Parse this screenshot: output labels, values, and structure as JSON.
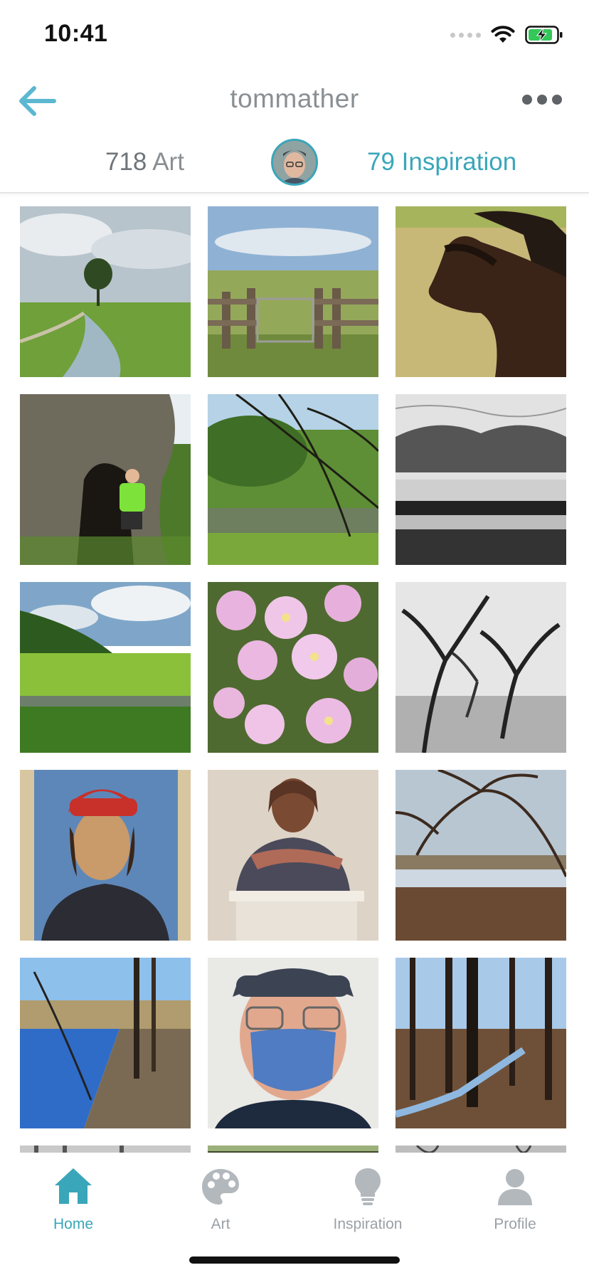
{
  "status_bar": {
    "time": "10:41"
  },
  "header": {
    "title": "tommather"
  },
  "stats": {
    "art_count": "718",
    "art_label": "Art",
    "inspiration_count": "79",
    "inspiration_label": "Inspiration"
  },
  "grid": {
    "items": [
      {
        "subject": "tree-lined polder ditch"
      },
      {
        "subject": "gate on dike by the sea"
      },
      {
        "subject": "two dark horses"
      },
      {
        "subject": "man in hollow tree"
      },
      {
        "subject": "pond with overhanging branches"
      },
      {
        "subject": "pencil drawing of marsh"
      },
      {
        "subject": "green marsh under clouds"
      },
      {
        "subject": "pink primrose flowers"
      },
      {
        "subject": "pencil drawing of orchard trees"
      },
      {
        "subject": "renaissance portrait with red cap"
      },
      {
        "subject": "terracotta bust"
      },
      {
        "subject": "bare tree over wetland"
      },
      {
        "subject": "riverbank trees"
      },
      {
        "subject": "selfie with blue mask"
      },
      {
        "subject": "forest stream"
      }
    ]
  },
  "tab_bar": {
    "tabs": [
      {
        "label": "Home",
        "icon": "home-icon",
        "active": true
      },
      {
        "label": "Art",
        "icon": "palette-icon",
        "active": false
      },
      {
        "label": "Inspiration",
        "icon": "lightbulb-icon",
        "active": false
      },
      {
        "label": "Profile",
        "icon": "person-icon",
        "active": false
      }
    ]
  },
  "colors": {
    "accent": "#3aa6b9",
    "inactive": "#9aa0a6",
    "title_gray": "#8a8f93"
  }
}
